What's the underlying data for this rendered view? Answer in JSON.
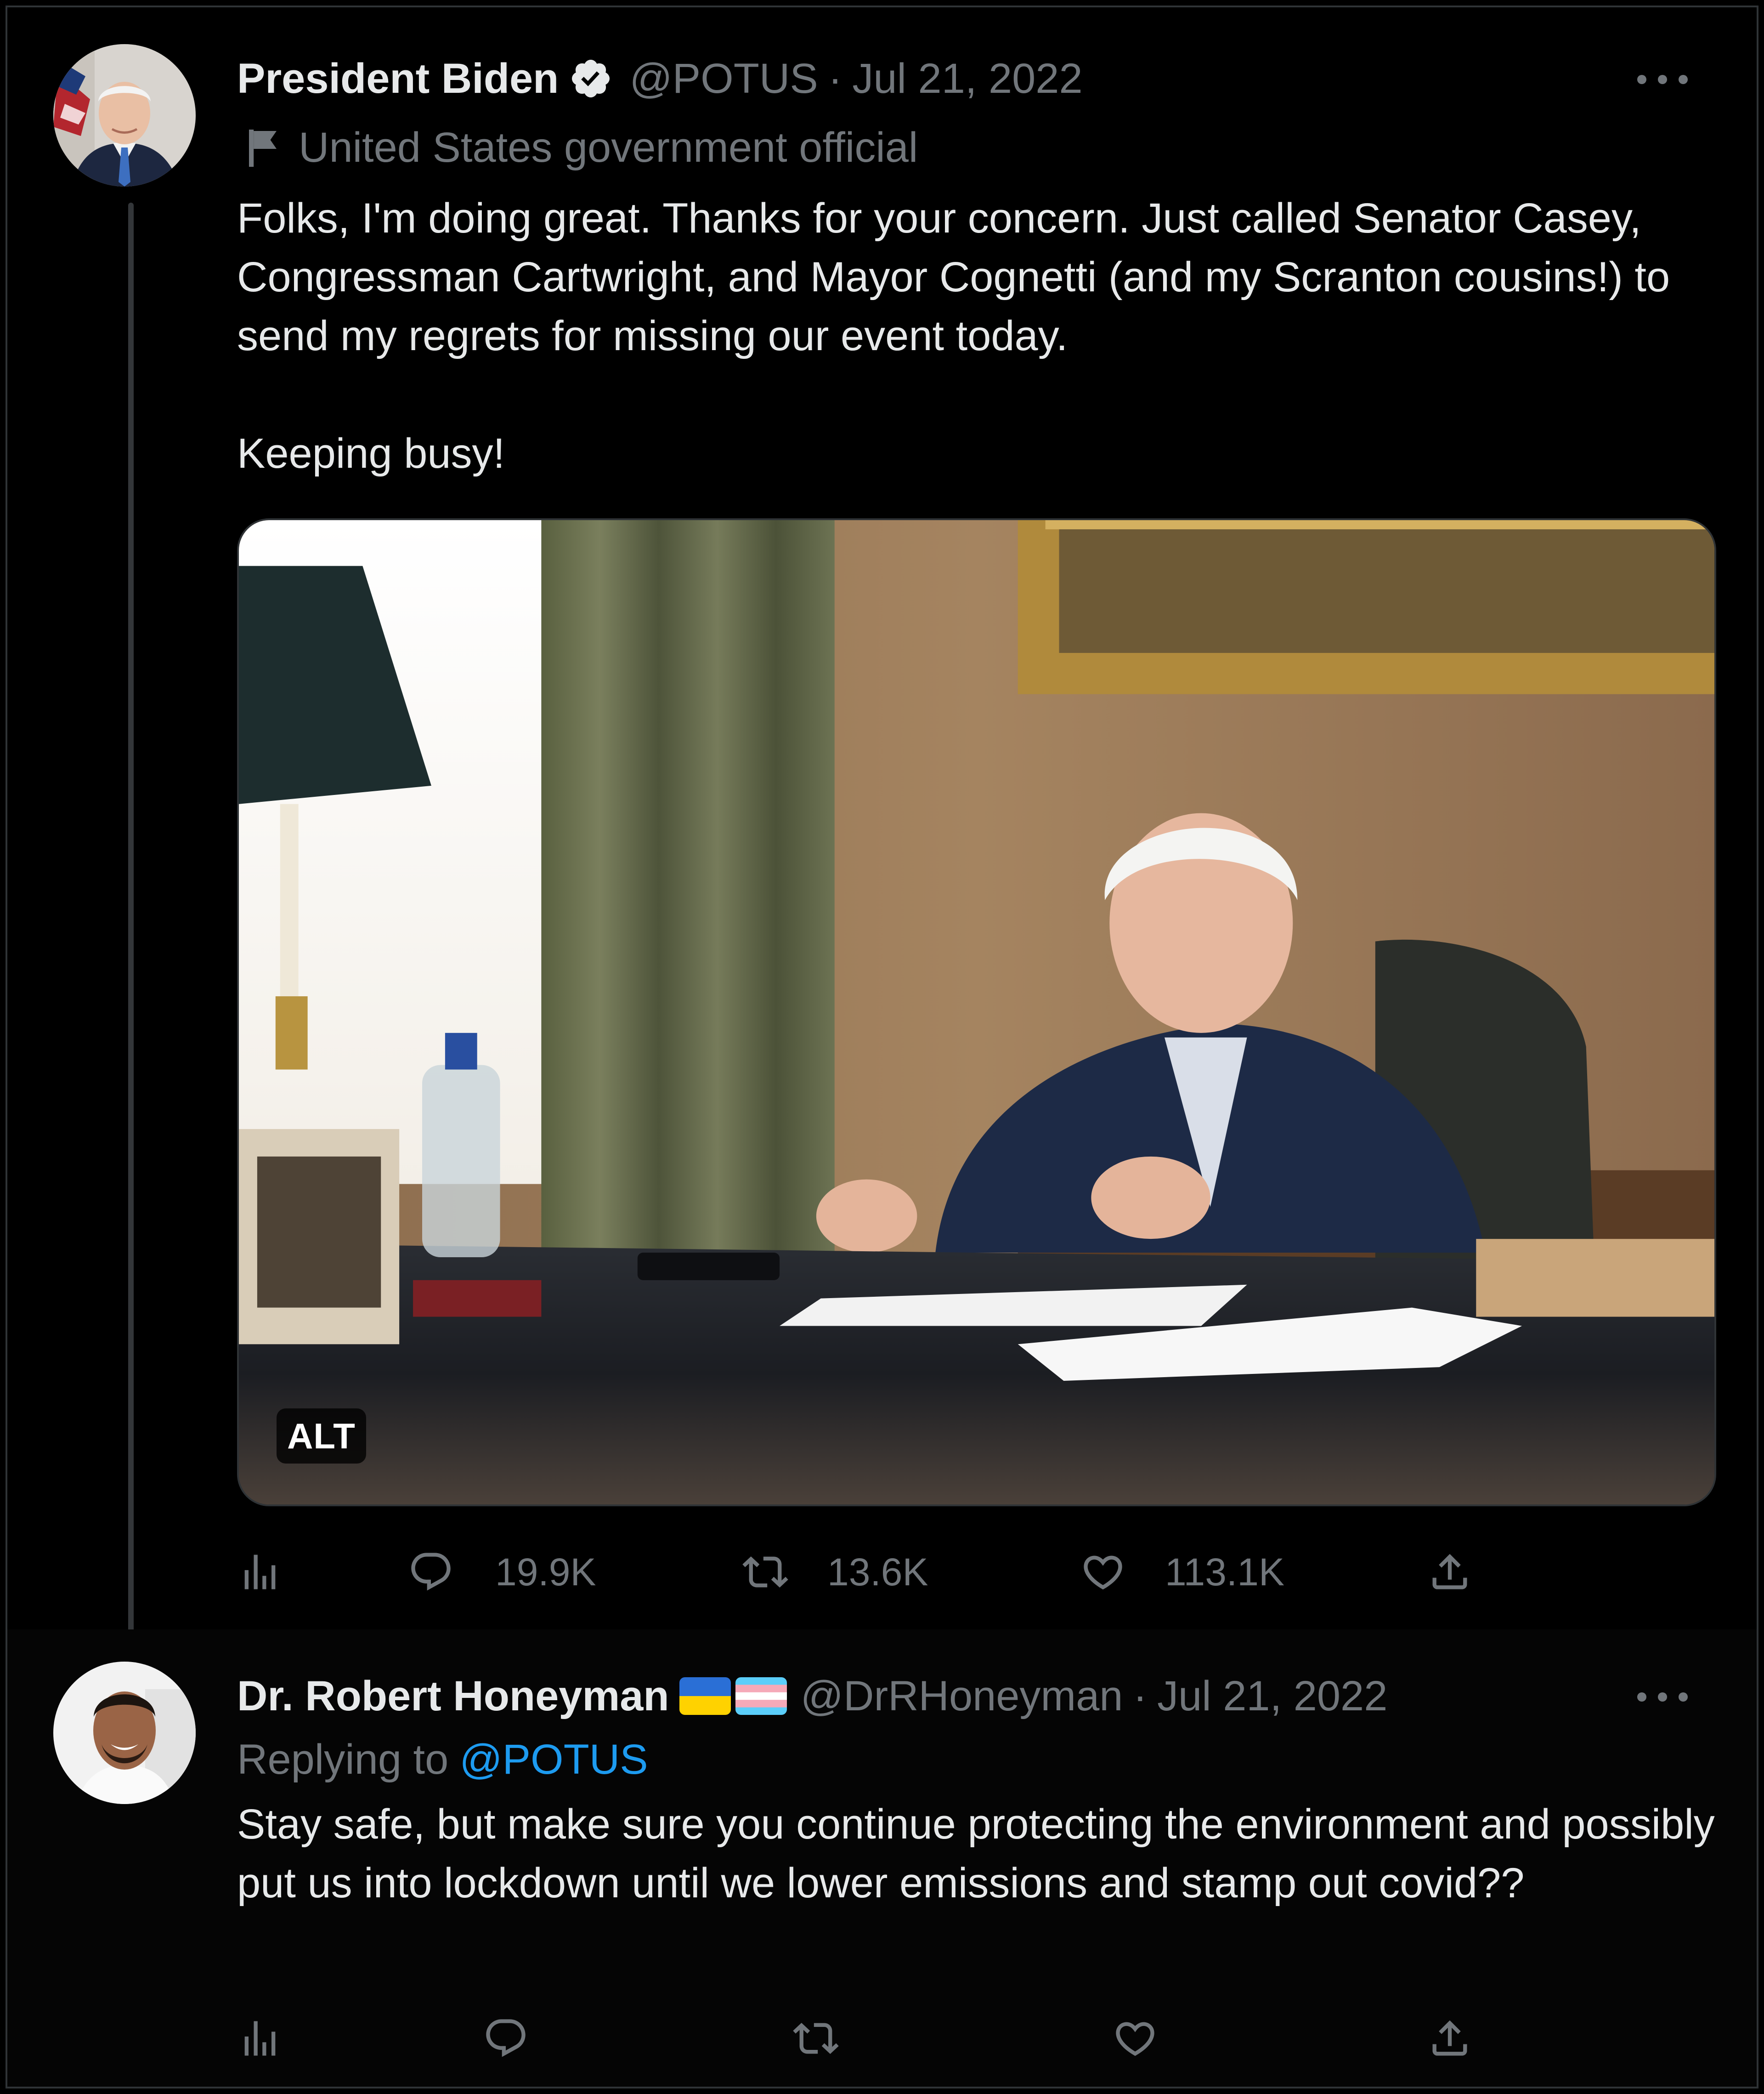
{
  "tweet_main": {
    "display_name": "President Biden",
    "verified": true,
    "handle": "@POTUS",
    "separator": "·",
    "date": "Jul 21, 2022",
    "label": "United States government official",
    "text": "Folks, I'm doing great. Thanks for your concern. Just called Senator Casey, Congressman Cartwright, and Mayor Cognetti (and my Scranton cousins!) to send my regrets for missing our event today.\n\nKeeping busy!",
    "media": {
      "alt_badge": "ALT"
    },
    "actions": {
      "views_icon": "analytics-icon",
      "reply_count": "19.9K",
      "retweet_count": "13.6K",
      "like_count": "113.1K",
      "share_icon": "share-icon"
    }
  },
  "tweet_reply": {
    "display_name": "Dr. Robert Honeyman",
    "name_emojis": [
      "ukraine-flag",
      "transgender-flag"
    ],
    "handle": "@DrRHoneyman",
    "separator": "·",
    "date": "Jul 21, 2022",
    "replying_to_label": "Replying to",
    "replying_to_handle": "@POTUS",
    "text": "Stay safe, but make sure you continue protecting the environment and possibly put us into lockdown until we lower emissions and stamp out covid??",
    "actions": {
      "views_icon": "analytics-icon",
      "reply_icon": "reply-icon",
      "retweet_icon": "retweet-icon",
      "like_icon": "like-icon",
      "share_icon": "share-icon"
    }
  },
  "colors": {
    "background": "#000000",
    "text_primary": "#e7e9ea",
    "text_secondary": "#71767b",
    "accent": "#1d9bf0",
    "border": "#2f3336"
  }
}
